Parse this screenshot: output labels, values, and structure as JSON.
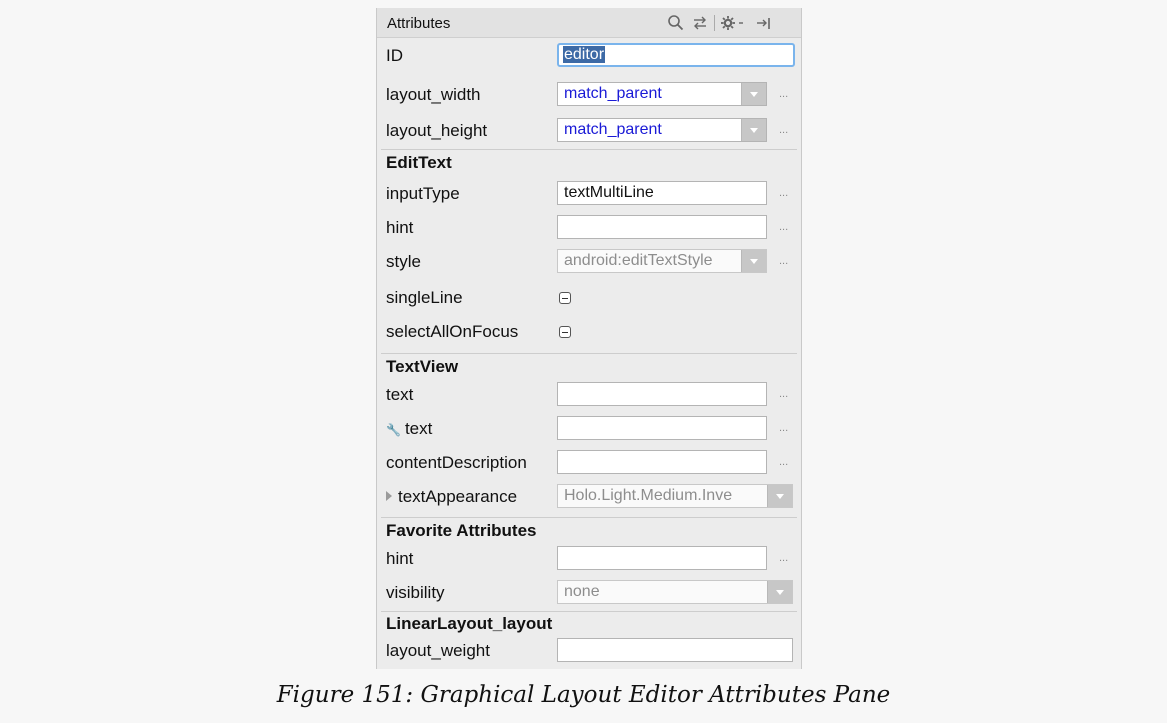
{
  "pane": {
    "title": "Attributes",
    "toolbar_icons": [
      "search-icon",
      "swap-icon",
      "gear-icon",
      "pin-right-icon"
    ]
  },
  "rows": {
    "id": {
      "label": "ID",
      "value": "editor"
    },
    "layout_width": {
      "label": "layout_width",
      "value": "match_parent"
    },
    "layout_height": {
      "label": "layout_height",
      "value": "match_parent"
    },
    "section_edittext": "EditText",
    "inputType": {
      "label": "inputType",
      "value": "textMultiLine"
    },
    "hint": {
      "label": "hint",
      "value": ""
    },
    "style": {
      "label": "style",
      "value": "android:editTextStyle"
    },
    "singleLine": {
      "label": "singleLine"
    },
    "selectAllOnFocus": {
      "label": "selectAllOnFocus"
    },
    "section_textview": "TextView",
    "text": {
      "label": "text",
      "value": ""
    },
    "tools_text": {
      "label": "text",
      "value": ""
    },
    "contentDescription": {
      "label": "contentDescription",
      "value": ""
    },
    "textAppearance": {
      "label": "textAppearance",
      "value": "Holo.Light.Medium.Inve"
    },
    "section_favorite": "Favorite Attributes",
    "fav_hint": {
      "label": "hint",
      "value": ""
    },
    "visibility": {
      "label": "visibility",
      "value": "none"
    },
    "section_linearlayout": "LinearLayout_layout",
    "layout_weight": {
      "label": "layout_weight",
      "value": ""
    }
  },
  "more_button_label": "...",
  "caption": "Figure 151: Graphical Layout Editor Attributes Pane"
}
